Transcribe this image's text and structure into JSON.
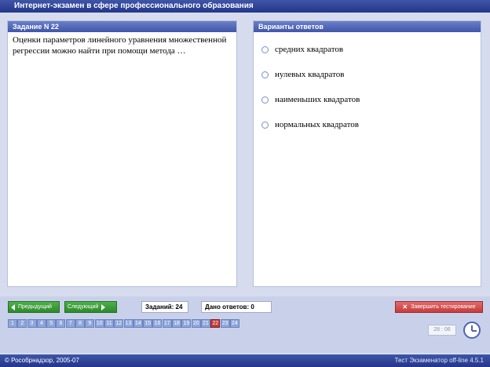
{
  "window_title": "Интернет-экзамен в сфере профессионального образования",
  "question_panel": {
    "header": "Задание N 22",
    "text": "Оценки параметров линейного уравнения множественной регрессии можно найти при помощи метода …"
  },
  "answers_panel": {
    "header": "Варианты ответов",
    "options": [
      "средних квадратов",
      "нулевых квадратов",
      "наименьших квадратов",
      "нормальных квадратов"
    ]
  },
  "navigation": {
    "prev_label": "Предыдущий",
    "next_label": "Следующий",
    "tasks_count": "Заданий: 24",
    "answers_given": "Дано ответов: 0",
    "finish_label": "Завершить тестирование"
  },
  "pages": [
    "1",
    "2",
    "3",
    "4",
    "5",
    "6",
    "7",
    "8",
    "9",
    "10",
    "11",
    "12",
    "13",
    "14",
    "15",
    "16",
    "17",
    "18",
    "19",
    "20",
    "21",
    "22",
    "23",
    "24"
  ],
  "current_page": "22",
  "timer": "28 : 06",
  "status": {
    "copyright": "© Рособрнадзор, 2005-07",
    "version": "Тест Экзаменатор off-line 4.5.1"
  },
  "colors": {
    "accent": "#3f55a8",
    "button_green": "#2c8a2b",
    "button_red": "#c63c3c",
    "active_page": "#c23b3b"
  },
  "icons": {
    "prev": "triangle-left-icon",
    "next": "triangle-right-icon",
    "finish": "runner-icon",
    "clock": "clock-icon"
  }
}
